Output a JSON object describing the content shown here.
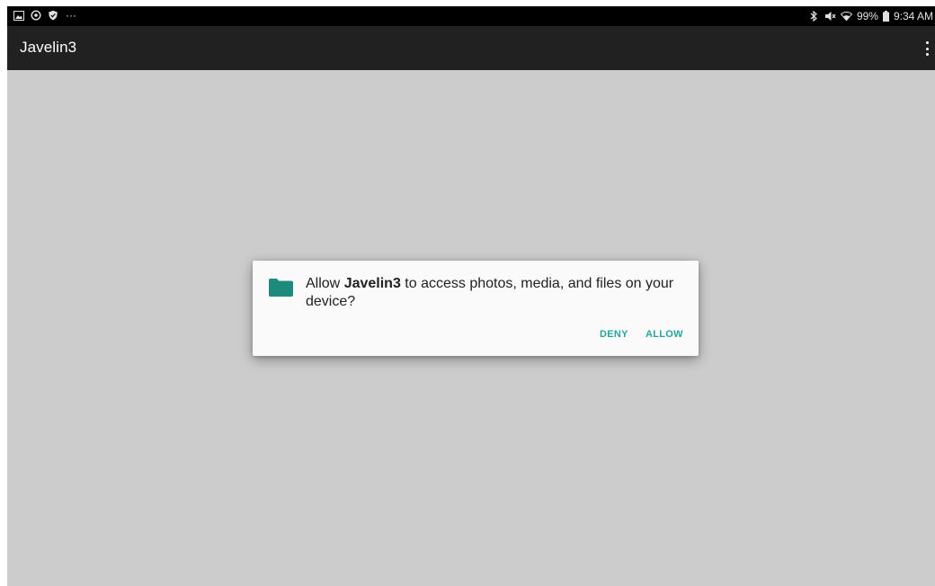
{
  "status_bar": {
    "left_icons": [
      "gallery-icon",
      "sync-icon",
      "shield-icon"
    ],
    "more_indicator": "···",
    "battery_text": "99%",
    "time": "9:34 AM",
    "right_icons": [
      "bluetooth-icon",
      "mute-icon",
      "wifi-icon",
      "battery-icon"
    ]
  },
  "app_bar": {
    "title": "Javelin3",
    "menu_icon": "more-vert-icon"
  },
  "dialog": {
    "message_prefix": "Allow ",
    "app_name": "Javelin3",
    "message_suffix": " to access photos, media, and files on your device?",
    "icon": "folder-icon",
    "deny_label": "DENY",
    "allow_label": "ALLOW"
  },
  "colors": {
    "accent": "#26a69a",
    "background": "#cccccc",
    "app_bar": "#212121",
    "status_bar": "#000000",
    "dialog": "#fafafa"
  }
}
